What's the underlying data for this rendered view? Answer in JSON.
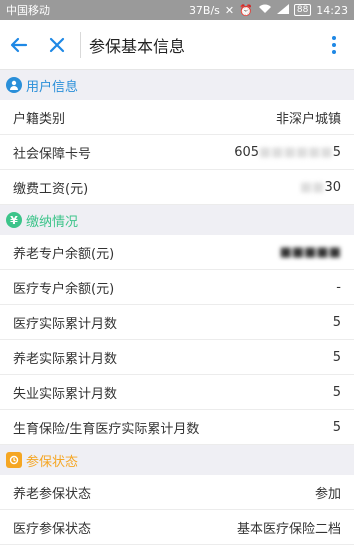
{
  "status_bar": {
    "carrier": "中国移动",
    "speed": "37B/s",
    "battery": "88",
    "time": "14:23"
  },
  "header": {
    "title": "参保基本信息"
  },
  "sections": {
    "user_info": {
      "title": "用户信息",
      "icon": "person-icon",
      "color": "#2a8fd9",
      "rows": [
        {
          "label": "户籍类别",
          "value": "非深户城镇"
        },
        {
          "label": "社会保障卡号",
          "value": "605",
          "value_tail": "5"
        },
        {
          "label": "缴费工资(元)",
          "value": "30"
        }
      ]
    },
    "payment": {
      "title": "缴纳情况",
      "icon": "yen-icon",
      "color": "#3cc48a",
      "rows": [
        {
          "label": "养老专户余额(元)",
          "value": ""
        },
        {
          "label": "医疗专户余额(元)",
          "value": "-"
        },
        {
          "label": "医疗实际累计月数",
          "value": "5"
        },
        {
          "label": "养老实际累计月数",
          "value": "5"
        },
        {
          "label": "失业实际累计月数",
          "value": "5"
        },
        {
          "label": "生育保险/生育医疗实际累计月数",
          "value": "5"
        }
      ]
    },
    "status": {
      "title": "参保状态",
      "icon": "status-icon",
      "color": "#f5a623",
      "rows": [
        {
          "label": "养老参保状态",
          "value": "参加"
        },
        {
          "label": "医疗参保状态",
          "value": "基本医疗保险二档"
        }
      ]
    }
  }
}
